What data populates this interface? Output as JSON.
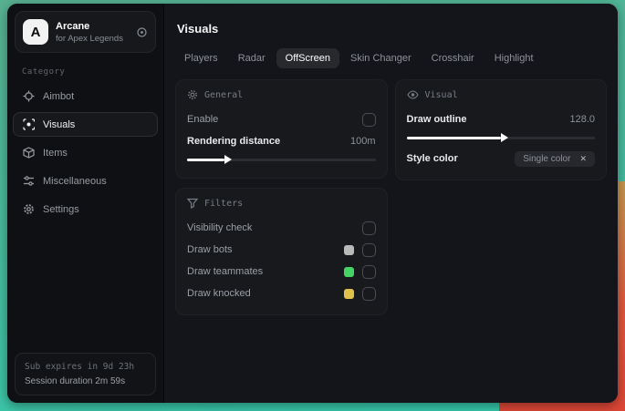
{
  "app": {
    "name": "Arcane",
    "subtitle": "for Apex Legends",
    "logo_letter": "A"
  },
  "sidebar": {
    "category_label": "Category",
    "items": [
      {
        "label": "Aimbot",
        "icon": "crosshair-icon"
      },
      {
        "label": "Visuals",
        "icon": "eye-scan-icon",
        "active": true
      },
      {
        "label": "Items",
        "icon": "box-icon"
      },
      {
        "label": "Miscellaneous",
        "icon": "sliders-icon"
      },
      {
        "label": "Settings",
        "icon": "gear-icon"
      }
    ],
    "footer": {
      "sub_expires": "Sub expires in 9d 23h",
      "session_duration": "Session duration 2m 59s"
    }
  },
  "main": {
    "title": "Visuals",
    "tabs": [
      {
        "label": "Players"
      },
      {
        "label": "Radar"
      },
      {
        "label": "OffScreen",
        "active": true
      },
      {
        "label": "Skin Changer"
      },
      {
        "label": "Crosshair"
      },
      {
        "label": "Highlight"
      }
    ],
    "panels": {
      "general": {
        "title": "General",
        "icon": "sun-icon",
        "rows": [
          {
            "label": "Enable",
            "control": "checkbox",
            "checked": false
          },
          {
            "label": "Rendering distance",
            "value": "100m",
            "control": "slider",
            "percent": 20
          }
        ]
      },
      "visual": {
        "title": "Visual",
        "icon": "eye-icon",
        "rows": [
          {
            "label": "Draw outline",
            "value": "128.0",
            "control": "slider",
            "percent": 50
          },
          {
            "label": "Style color",
            "control": "dropdown-chip",
            "chip_label": "Single color",
            "chip_close": "✕"
          }
        ]
      },
      "filters": {
        "title": "Filters",
        "icon": "funnel-icon",
        "rows": [
          {
            "label": "Visibility check",
            "checked": false
          },
          {
            "label": "Draw bots",
            "swatch": "#b9b9b9",
            "checked": false
          },
          {
            "label": "Draw teammates",
            "swatch": "#43d465",
            "checked": false
          },
          {
            "label": "Draw knocked",
            "swatch": "#e2c04c",
            "checked": false
          }
        ]
      }
    }
  },
  "colors": {
    "background_teal": "#48ba9c",
    "background_red": "#dd4636",
    "accent_white": "#ffffff"
  }
}
